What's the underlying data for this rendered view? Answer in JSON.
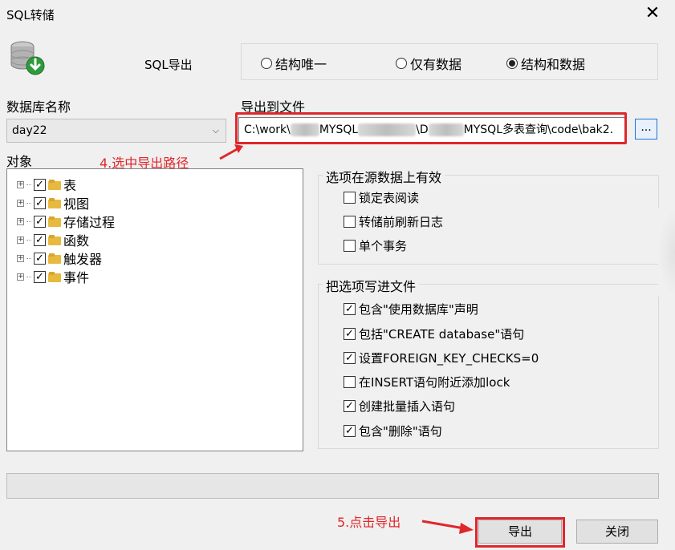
{
  "window": {
    "title": "SQL转储",
    "close_glyph": "✕"
  },
  "header": {
    "export_label": "SQL导出",
    "modes": [
      {
        "label": "结构唯一",
        "selected": false
      },
      {
        "label": "仅有数据",
        "selected": false
      },
      {
        "label": "结构和数据",
        "selected": true
      }
    ]
  },
  "database": {
    "label": "数据库名称",
    "selected": "day22"
  },
  "export_file": {
    "label": "导出到文件",
    "path_segments": [
      "C:\\work\\",
      "MYSQL",
      "\\D",
      "MYSQL多表查询\\code\\bak2."
    ],
    "browse_label": "..."
  },
  "objects": {
    "label": "对象",
    "items": [
      {
        "label": "表",
        "checked": true
      },
      {
        "label": "视图",
        "checked": true
      },
      {
        "label": "存储过程",
        "checked": true
      },
      {
        "label": "函数",
        "checked": true
      },
      {
        "label": "触发器",
        "checked": true
      },
      {
        "label": "事件",
        "checked": true
      }
    ]
  },
  "source_options": {
    "title": "选项在源数据上有效",
    "items": [
      {
        "label": "锁定表阅读",
        "checked": false
      },
      {
        "label": "转储前刷新日志",
        "checked": false
      },
      {
        "label": "单个事务",
        "checked": false
      }
    ]
  },
  "file_options": {
    "title": "把选项写进文件",
    "items": [
      {
        "label": "包含\"使用数据库\"声明",
        "checked": true
      },
      {
        "label": "包括\"CREATE database\"语句",
        "checked": true
      },
      {
        "label": "设置FOREIGN_KEY_CHECKS=0",
        "checked": true
      },
      {
        "label": "在INSERT语句附近添加lock",
        "checked": false
      },
      {
        "label": "创建批量插入语句",
        "checked": true
      },
      {
        "label": "包含\"删除\"语句",
        "checked": true
      }
    ]
  },
  "progress": {
    "value": 0
  },
  "buttons": {
    "export": "导出",
    "close": "关闭"
  },
  "annotations": {
    "step4": "4.选中导出路径",
    "step5": "5.点击导出"
  },
  "colors": {
    "annotation": "#e0262b",
    "accent": "#1e74d4"
  }
}
